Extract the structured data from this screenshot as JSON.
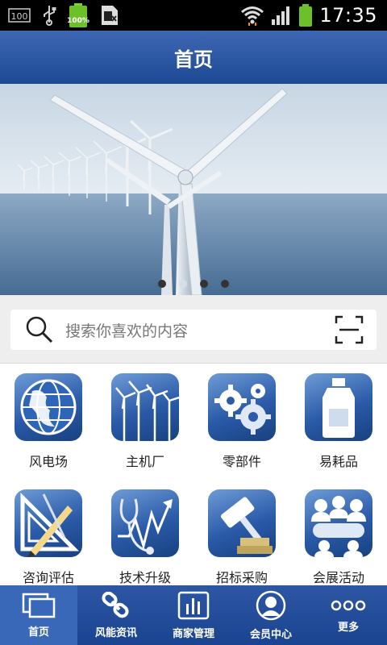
{
  "status_bar": {
    "left_icons": [
      "storage-100-icon",
      "usb-icon",
      "battery-charging-icon",
      "sim-icon"
    ],
    "battery_text": "100%",
    "storage_text": "100",
    "right_icons": [
      "wifi-icon",
      "signal-icon",
      "battery-icon"
    ],
    "time": "17:35"
  },
  "header": {
    "title": "首页"
  },
  "banner": {
    "slide_count": 4,
    "active_slide": 2
  },
  "search": {
    "placeholder": "搜索你喜欢的内容"
  },
  "grid": {
    "items": [
      {
        "label": "风电场",
        "icon": "globe-icon"
      },
      {
        "label": "主机厂",
        "icon": "wind-turbines-icon"
      },
      {
        "label": "零部件",
        "icon": "gears-icon"
      },
      {
        "label": "易耗品",
        "icon": "oil-bottle-icon"
      },
      {
        "label": "咨询评估",
        "icon": "drafting-tools-icon"
      },
      {
        "label": "技术升级",
        "icon": "stethoscope-chart-icon"
      },
      {
        "label": "招标采购",
        "icon": "auction-gavel-icon"
      },
      {
        "label": "会展活动",
        "icon": "meeting-icon"
      }
    ]
  },
  "tabs": [
    {
      "label": "首页",
      "icon": "home-windows-icon",
      "active": true
    },
    {
      "label": "风能资讯",
      "icon": "link-icon",
      "active": false
    },
    {
      "label": "商家管理",
      "icon": "bar-chart-icon",
      "active": false
    },
    {
      "label": "会员中心",
      "icon": "user-icon",
      "active": false
    },
    {
      "label": "更多",
      "icon": "more-icon",
      "active": false
    }
  ]
}
